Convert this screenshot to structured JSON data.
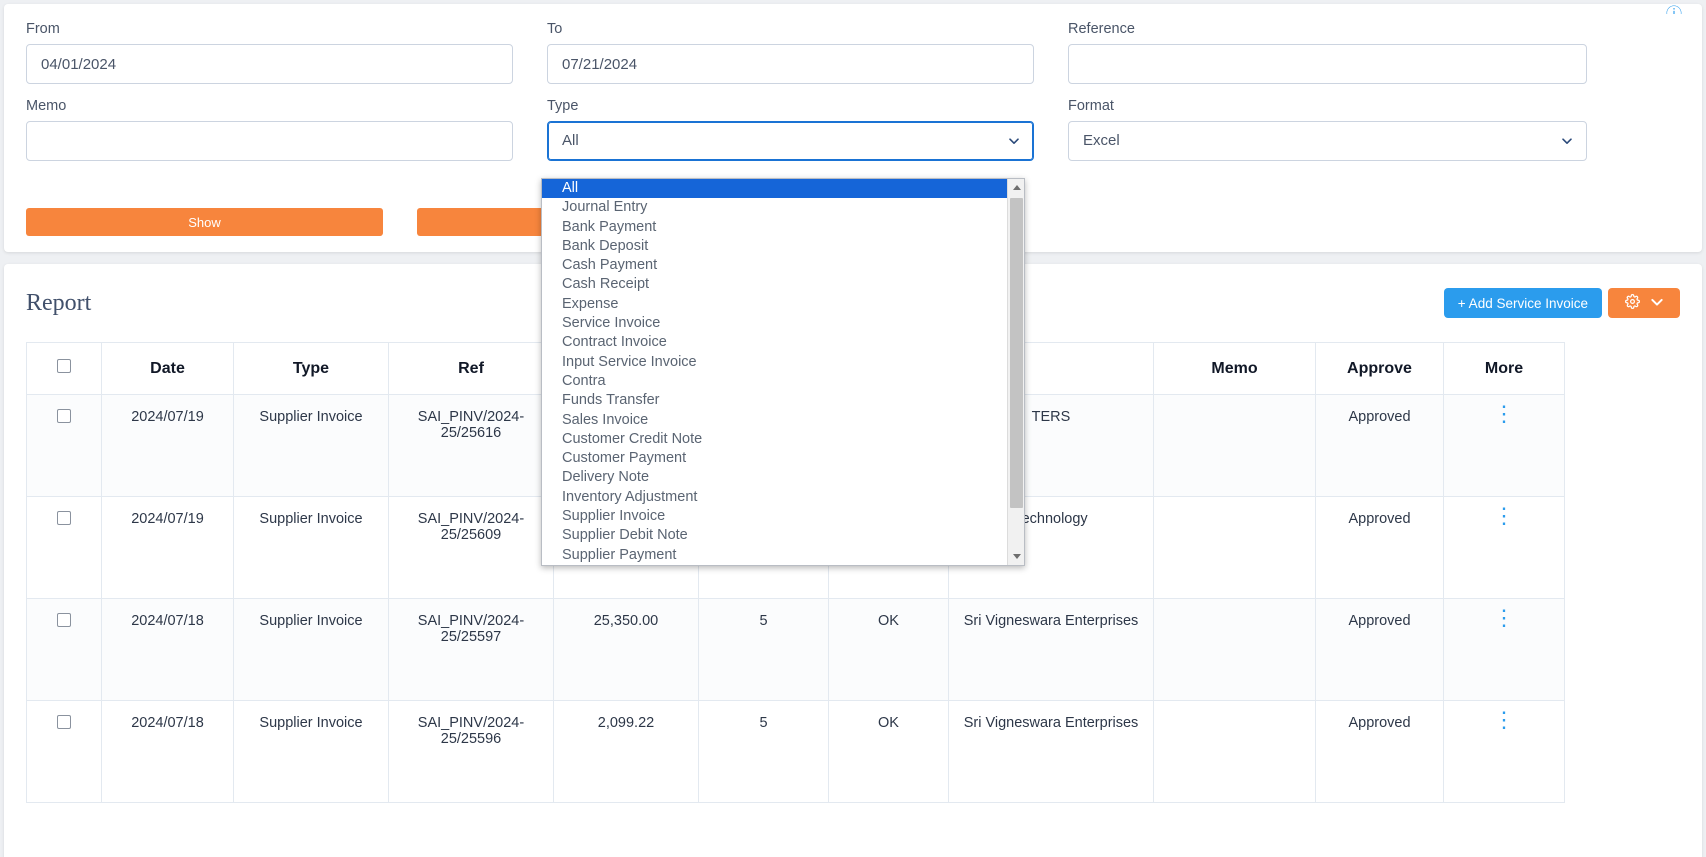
{
  "filters": {
    "from": {
      "label": "From",
      "value": "04/01/2024",
      "placeholder": ""
    },
    "to": {
      "label": "To",
      "value": "07/21/2024",
      "placeholder": ""
    },
    "reference": {
      "label": "Reference",
      "value": "",
      "placeholder": ""
    },
    "memo": {
      "label": "Memo",
      "value": "",
      "placeholder": ""
    },
    "type": {
      "label": "Type",
      "value": "All"
    },
    "format": {
      "label": "Format",
      "value": "Excel"
    },
    "show_button": "Show",
    "second_button": ""
  },
  "type_dropdown": {
    "selected": "All",
    "options": [
      "All",
      "Journal Entry",
      "Bank Payment",
      "Bank Deposit",
      "Cash Payment",
      "Cash Receipt",
      "Expense",
      "Service Invoice",
      "Contract Invoice",
      "Input Service Invoice",
      "Contra",
      "Funds Transfer",
      "Sales Invoice",
      "Customer Credit Note",
      "Customer Payment",
      "Delivery Note",
      "Inventory Adjustment",
      "Supplier Invoice",
      "Supplier Debit Note",
      "Supplier Payment"
    ]
  },
  "report": {
    "title": "Report",
    "add_button": "+ Add Service Invoice",
    "gear_icon": "gear-icon",
    "chevron_icon": "chevron-down-icon"
  },
  "table": {
    "columns": [
      "",
      "Date",
      "Type",
      "Ref",
      "",
      "",
      "",
      "",
      "Memo",
      "Approve",
      "More"
    ],
    "rows": [
      {
        "date": "2024/07/19",
        "type": "Supplier Invoice",
        "ref": "SAI_PINV/2024-25/25616",
        "amount": "",
        "num": "",
        "status": "",
        "description": "TERS",
        "memo": "",
        "approve": "Approved",
        "more": "more-options-icon"
      },
      {
        "date": "2024/07/19",
        "type": "Supplier Invoice",
        "ref": "SAI_PINV/2024-25/25609",
        "amount": "",
        "num": "",
        "status": "",
        "description": "Technology",
        "memo": "",
        "approve": "Approved",
        "more": "more-options-icon"
      },
      {
        "date": "2024/07/18",
        "type": "Supplier Invoice",
        "ref": "SAI_PINV/2024-25/25597",
        "amount": "25,350.00",
        "num": "5",
        "status": "OK",
        "description": "Sri Vigneswara Enterprises",
        "memo": "",
        "approve": "Approved",
        "more": "more-options-icon"
      },
      {
        "date": "2024/07/18",
        "type": "Supplier Invoice",
        "ref": "SAI_PINV/2024-25/25596",
        "amount": "2,099.22",
        "num": "5",
        "status": "OK",
        "description": "Sri Vigneswara Enterprises",
        "memo": "",
        "approve": "Approved",
        "more": "more-options-icon"
      }
    ]
  },
  "colors": {
    "orange": "#f7853d",
    "blue": "#2b9ced",
    "link_blue": "#3aa5e8",
    "dropdown_highlight": "#1565d8"
  }
}
